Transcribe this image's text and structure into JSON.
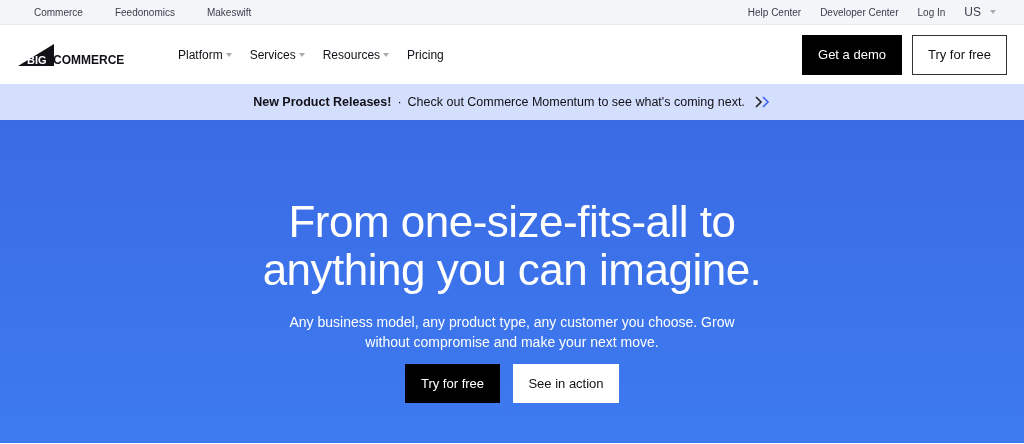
{
  "utility_bar": {
    "left_links": [
      "Commerce",
      "Feedonomics",
      "Makeswift"
    ],
    "right_links": [
      "Help Center",
      "Developer Center",
      "Log In"
    ],
    "region": "US"
  },
  "nav": {
    "logo": {
      "mark": "BIG",
      "wordmark": "COMMERCE"
    },
    "menu": [
      {
        "label": "Platform",
        "dropdown": true
      },
      {
        "label": "Services",
        "dropdown": true
      },
      {
        "label": "Resources",
        "dropdown": true
      },
      {
        "label": "Pricing",
        "dropdown": false
      }
    ],
    "buttons": [
      {
        "label": "Get a demo",
        "kind": "primary"
      },
      {
        "label": "Try for free",
        "kind": "outline"
      }
    ]
  },
  "announcement": {
    "headline": "New Product Releases!",
    "separator": "·",
    "text": "Check out Commerce Momentum to see what's coming next."
  },
  "hero": {
    "title": "From one-size-fits-all to anything you can imagine.",
    "subtitle": "Any business model, any product type, any customer you choose. Grow without compromise and make your next move.",
    "buttons": [
      {
        "label": "Try for free",
        "kind": "dark"
      },
      {
        "label": "See in action",
        "kind": "light"
      }
    ]
  }
}
